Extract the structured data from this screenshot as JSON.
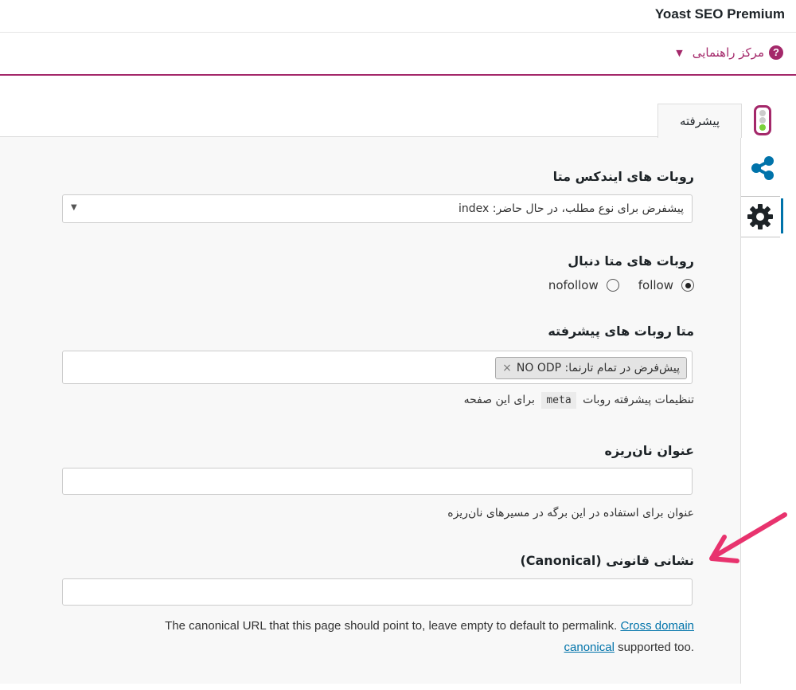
{
  "header": {
    "plugin_title": "Yoast SEO Premium"
  },
  "help": {
    "label": "مرکز راهنمایی",
    "icon": "question-icon"
  },
  "side_tabs": [
    {
      "icon": "traffic-light-icon"
    },
    {
      "icon": "share-icon"
    },
    {
      "icon": "gear-icon"
    }
  ],
  "tab": {
    "label": "پیشرفته"
  },
  "meta_robots_index": {
    "label": "روبات های ایندکس متا",
    "selected": "پیشفرض برای نوع مطلب، در حال حاضر: index"
  },
  "meta_robots_follow": {
    "label": "روبات های متا دنبال",
    "options": [
      "follow",
      "nofollow"
    ],
    "selected": "follow"
  },
  "meta_robots_advanced": {
    "label": "متا روبات های پیشرفته",
    "chip": "پیش‌فرض در تمام تارنما: NO ODP",
    "chip_remove": "×",
    "desc_before": "تنظیمات پیشرفته روبات",
    "desc_code": "meta",
    "desc_after": "برای این صفحه"
  },
  "breadcrumb_title": {
    "label": "عنوان نان‌ریزه",
    "value": "",
    "desc": "عنوان برای استفاده در این برگه در مسیرهای نان‌ریزه"
  },
  "canonical": {
    "label": "نشانی قانونی (Canonical)",
    "value": "",
    "desc_text": "The canonical URL that this page should point to, leave empty to default to permalink.",
    "link1": "Cross domain",
    "link2": "canonical",
    "desc_tail": "supported too."
  },
  "colors": {
    "brand": "#a4286a",
    "link": "#0073aa",
    "annotation_arrow": "#e8336e"
  }
}
